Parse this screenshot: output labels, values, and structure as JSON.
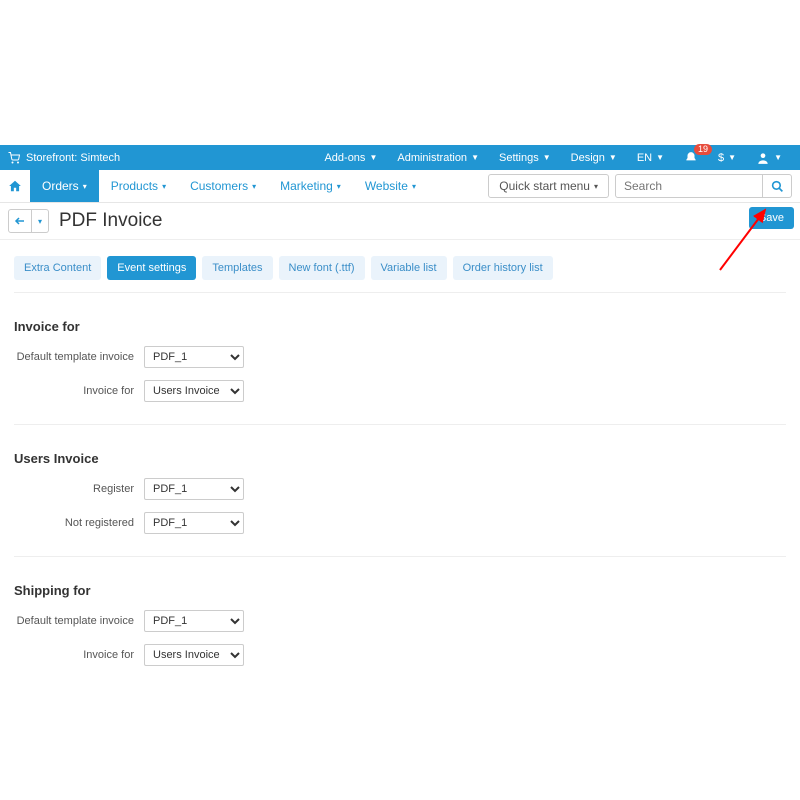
{
  "topbar": {
    "storefront_label": "Storefront: Simtech",
    "items": [
      "Add-ons",
      "Administration",
      "Settings",
      "Design",
      "EN"
    ],
    "badge": "19",
    "currency": "$"
  },
  "nav": {
    "items": [
      "Orders",
      "Products",
      "Customers",
      "Marketing",
      "Website"
    ],
    "active": 0,
    "quick_label": "Quick start menu",
    "search_placeholder": "Search"
  },
  "page": {
    "title": "PDF Invoice",
    "save_label": "Save"
  },
  "tabs": {
    "items": [
      "Extra Content",
      "Event settings",
      "Templates",
      "New font (.ttf)",
      "Variable list",
      "Order history list"
    ],
    "active": 1
  },
  "sections": {
    "invoice_for": {
      "title": "Invoice for",
      "rows": [
        {
          "label": "Default template invoice",
          "value": "PDF_1"
        },
        {
          "label": "Invoice for",
          "value": "Users Invoice"
        }
      ]
    },
    "users_invoice": {
      "title": "Users Invoice",
      "rows": [
        {
          "label": "Register",
          "value": "PDF_1"
        },
        {
          "label": "Not registered",
          "value": "PDF_1"
        }
      ]
    },
    "shipping_for": {
      "title": "Shipping for",
      "rows": [
        {
          "label": "Default template invoice",
          "value": "PDF_1"
        },
        {
          "label": "Invoice for",
          "value": "Users Invoice"
        }
      ]
    }
  }
}
